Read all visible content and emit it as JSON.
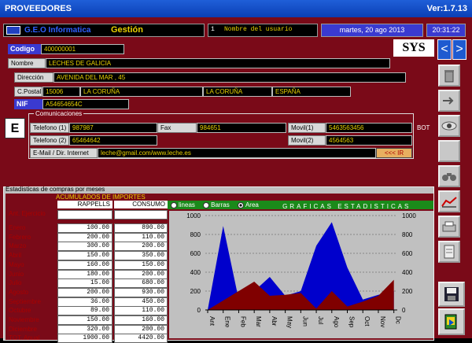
{
  "window": {
    "title": "PROVEEDORES",
    "version": "Ver:1.7.13"
  },
  "header": {
    "company": "G.E.O Informatica",
    "module": "Gestión",
    "user_num": "1",
    "user_label": "Nombre del usuario",
    "date": "martes, 20 ago 2013",
    "time": "20:31:22"
  },
  "supplier": {
    "codigo_label": "Codigo",
    "codigo": "400000001",
    "nombre_label": "Nombre",
    "nombre": "LECHES DE GALICIA",
    "direccion_label": "Dirección",
    "direccion": "AVENIDA DEL MAR , 45",
    "cpostal_label": "C.Postal",
    "cpostal": "15006",
    "ciudad": "LA CORUÑA",
    "provincia": "LA CORUÑA",
    "pais": "ESPAÑA",
    "nif_label": "NIF",
    "nif": "A54654654C",
    "sys": "SYS",
    "e_badge": "E",
    "side_text": "BOT"
  },
  "contact": {
    "title": "Comunicaciones",
    "tel1_label": "Telefono (1)",
    "tel1": "987987",
    "fax_label": "Fax",
    "fax": "984651",
    "movil1_label": "Movil(1)",
    "movil1": "5463563456",
    "tel2_label": "Telefono (2)",
    "tel2": "65464642",
    "movil2_label": "Movil(2)",
    "movil2": "4564563",
    "email_label": "E-Mail / Dir. Internet",
    "email": "leche@gmail.com/www.leche.es",
    "ir_label": "<<< IR"
  },
  "stats": {
    "title": "Estadisticas de compras por meses",
    "acum_label": "ACUMULADOS DE IMPORTES",
    "col_rappells": "RAPPELLS",
    "col_consumo": "CONSUMO",
    "ant_label": "Ant. Ejercicio",
    "total_label": "TOT. Anual",
    "total_rappells": "1900.00",
    "total_consumo": "4420.00",
    "graph_title": "GRAFICAS ESTADISTICAS",
    "radio_lineas": "lineas",
    "radio_barras": "Barras",
    "radio_area": "Area",
    "selected_mode": "Area",
    "months": [
      {
        "name": "Enero",
        "rappells": "100.00",
        "consumo": "890.00"
      },
      {
        "name": "Febrero",
        "rappells": "200.00",
        "consumo": "110.00"
      },
      {
        "name": "Marzo",
        "rappells": "300.00",
        "consumo": "200.00"
      },
      {
        "name": "Abril",
        "rappells": "150.00",
        "consumo": "350.00"
      },
      {
        "name": "Mayo",
        "rappells": "160.00",
        "consumo": "150.00"
      },
      {
        "name": "Junio",
        "rappells": "180.00",
        "consumo": "200.00"
      },
      {
        "name": "Julio",
        "rappells": "15.00",
        "consumo": "680.00"
      },
      {
        "name": "Agosto",
        "rappells": "200.00",
        "consumo": "930.00"
      },
      {
        "name": "Septiembre",
        "rappells": "36.00",
        "consumo": "450.00"
      },
      {
        "name": "Octubre",
        "rappells": "89.00",
        "consumo": "110.00"
      },
      {
        "name": "Noviembre",
        "rappells": "150.00",
        "consumo": "160.00"
      },
      {
        "name": "Diciembre",
        "rappells": "320.00",
        "consumo": "200.00"
      }
    ]
  },
  "chart_data": {
    "type": "area",
    "categories": [
      "Ant",
      "Ene",
      "Feb",
      "Mar",
      "Abr",
      "May",
      "Jun",
      "Jul",
      "Ago",
      "Sep",
      "Oct",
      "Nov",
      "Dc"
    ],
    "series": [
      {
        "name": "CONSUMO",
        "color": "#0000cc",
        "values": [
          0,
          890,
          110,
          200,
          350,
          150,
          200,
          680,
          930,
          450,
          110,
          160,
          200
        ]
      },
      {
        "name": "RAPPELLS",
        "color": "#800000",
        "values": [
          0,
          100,
          200,
          300,
          150,
          160,
          180,
          15,
          200,
          36,
          89,
          150,
          320
        ]
      }
    ],
    "ylim": [
      0,
      1000
    ],
    "yticks": [
      0,
      200,
      400,
      600,
      800,
      1000
    ],
    "grid": true
  },
  "icons": [
    "trash-icon",
    "arrow-icon",
    "eye-icon",
    "blank-icon",
    "binoculars-icon",
    "chart-icon",
    "print-icon",
    "document-icon",
    "save-icon",
    "exit-icon"
  ]
}
